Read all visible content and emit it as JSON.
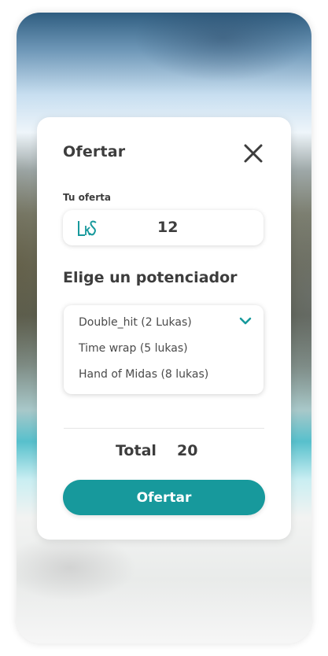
{
  "modal": {
    "title": "Ofertar",
    "offer_label": "Tu oferta",
    "offer_logo_text": "LkS",
    "offer_value": "12",
    "section_title": "Elige un potenciador",
    "dropdown_options": [
      "Double_hit (2 Lukas)",
      "Time wrap (5 lukas)",
      "Hand of Midas (8 lukas)"
    ],
    "total_label": "Total",
    "total_value": "20",
    "submit_label": "Ofertar"
  },
  "colors": {
    "accent": "#17999c",
    "text": "#3d3d3d"
  },
  "icons": {
    "close": "close-icon",
    "chevron": "chevron-down-icon",
    "logo": "lukas-logo-icon"
  }
}
